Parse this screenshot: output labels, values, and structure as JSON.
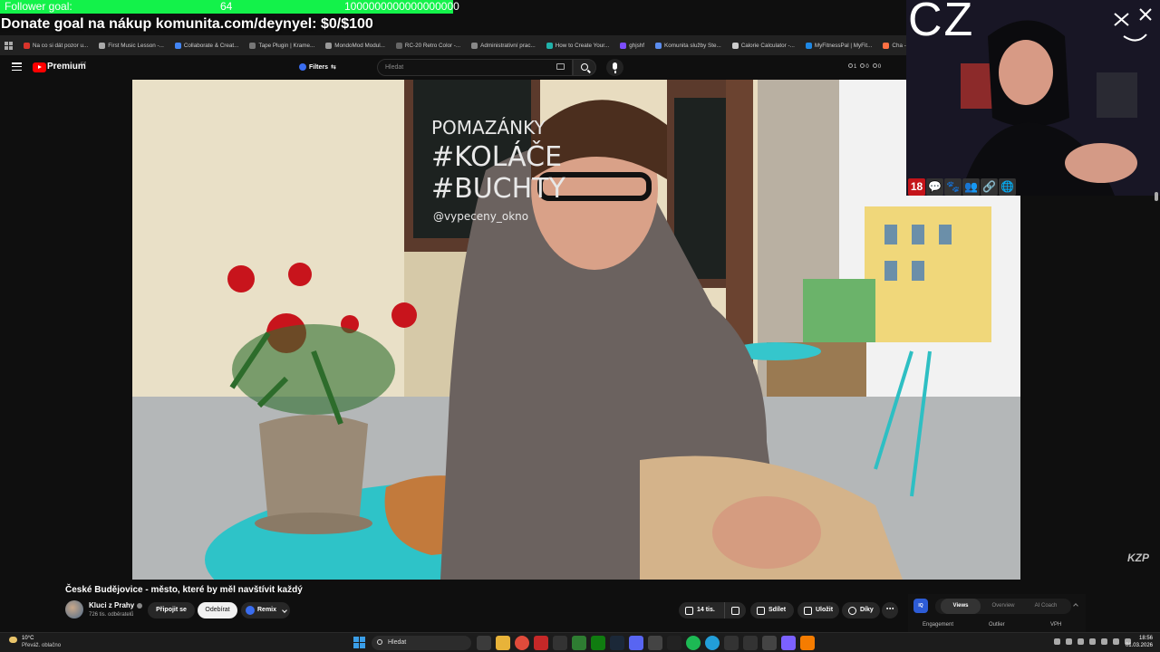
{
  "overlay": {
    "follower_goal": {
      "label": "Follower goal:",
      "current": "64",
      "target": "1000000000000000000"
    },
    "donate_goal": "Donate goal na nákup komunita.com/deynyel: $0/$100",
    "webcam_label": "CZ",
    "watermark": "KZP",
    "emotes": [
      "18",
      "💬",
      "🐾",
      "👥",
      "🔗",
      "🌐"
    ]
  },
  "bookmarks": [
    {
      "label": "Na co si dát pozor u...",
      "color": "#d9342b"
    },
    {
      "label": "First Music Lesson -...",
      "color": "#aaaaaa"
    },
    {
      "label": "Collaborate & Creat...",
      "color": "#4285f4"
    },
    {
      "label": "Tape Plugin | Krame...",
      "color": "#777777"
    },
    {
      "label": "MondoMod Modul...",
      "color": "#999999"
    },
    {
      "label": "RC-20 Retro Color -...",
      "color": "#666666"
    },
    {
      "label": "Administrativní prac...",
      "color": "#888888"
    },
    {
      "label": "How to Create Your...",
      "color": "#20b2aa"
    },
    {
      "label": "ghjshf",
      "color": "#7c4dff"
    },
    {
      "label": "Komunita služby Ste...",
      "color": "#5b8def"
    },
    {
      "label": "Calorie Calculator -...",
      "color": "#cccccc"
    },
    {
      "label": "MyFitnessPal | MyFit...",
      "color": "#1e88e5"
    },
    {
      "label": "Cha - Cha by Simon...",
      "color": "#ff7043"
    }
  ],
  "header": {
    "brand": "Premium",
    "region": "CZ",
    "filters_label": "Filters",
    "search_placeholder": "Hledat",
    "stats": [
      "1",
      "0",
      "0"
    ]
  },
  "video": {
    "title": "České Budějovice - město, které by měl navštívit každý",
    "channel": "Kluci z Prahy",
    "subscribers": "726 tis. odběratelů",
    "join_label": "Připojit se",
    "subscribe_label": "Odebírat",
    "remix_label": "Remix",
    "likes": "14 tis.",
    "share_label": "Sdílet",
    "save_label": "Uložit",
    "thanks_label": "Díky",
    "chalkboard_text": [
      "POMAZÁNKY",
      "#KOLÁČE",
      "#BUCHTY",
      "@vypeceny_okno"
    ]
  },
  "vidiq": {
    "tabs": [
      "Views",
      "Overview",
      "AI Coach"
    ],
    "metrics": [
      "Engagement",
      "Outlier",
      "VPH"
    ]
  },
  "taskbar": {
    "temperature": "10°C",
    "weather": "Převáž. oblačno",
    "search_label": "Hledat",
    "time": "18:56",
    "date": "01.03.2026"
  },
  "colors": {
    "goal_green": "#13f24a",
    "youtube_red": "#ff0000",
    "accent_blue": "#3a6df0"
  }
}
